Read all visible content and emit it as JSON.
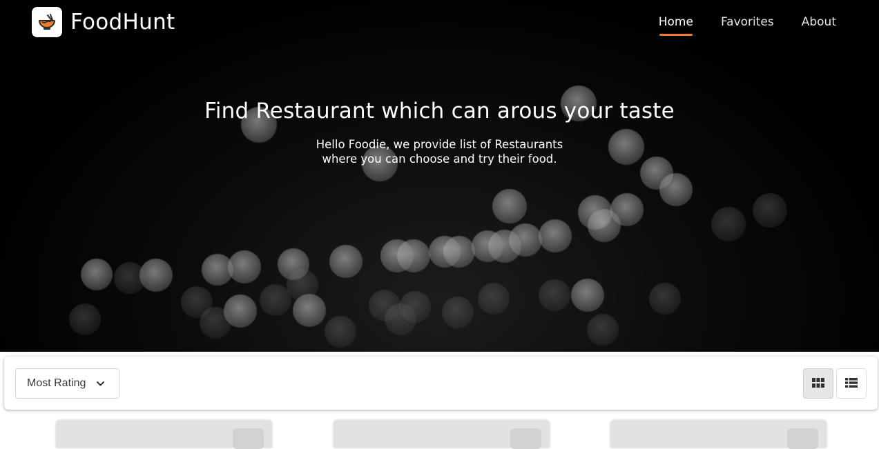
{
  "header": {
    "brand": "FoodHunt",
    "logo_icon": "noodle-bowl-icon",
    "nav": [
      {
        "label": "Home",
        "active": true
      },
      {
        "label": "Favorites",
        "active": false
      },
      {
        "label": "About",
        "active": false
      }
    ],
    "accent_color": "#f07c32"
  },
  "hero": {
    "title": "Find Restaurant which can arous your taste",
    "subtitle_line1": "Hello Foodie, we provide list of Restaurants",
    "subtitle_line2": "where you can choose and try their food."
  },
  "filters": {
    "sort_selected": "Most Rating",
    "sort_icon": "chevron-down-icon",
    "view_modes": [
      {
        "name": "grid",
        "icon": "grid-icon",
        "active": true
      },
      {
        "name": "list",
        "icon": "list-icon",
        "active": false
      }
    ]
  },
  "cards": [
    {
      "favorite_icon": "heart-icon"
    },
    {
      "favorite_icon": "heart-icon"
    },
    {
      "favorite_icon": "heart-icon"
    }
  ]
}
